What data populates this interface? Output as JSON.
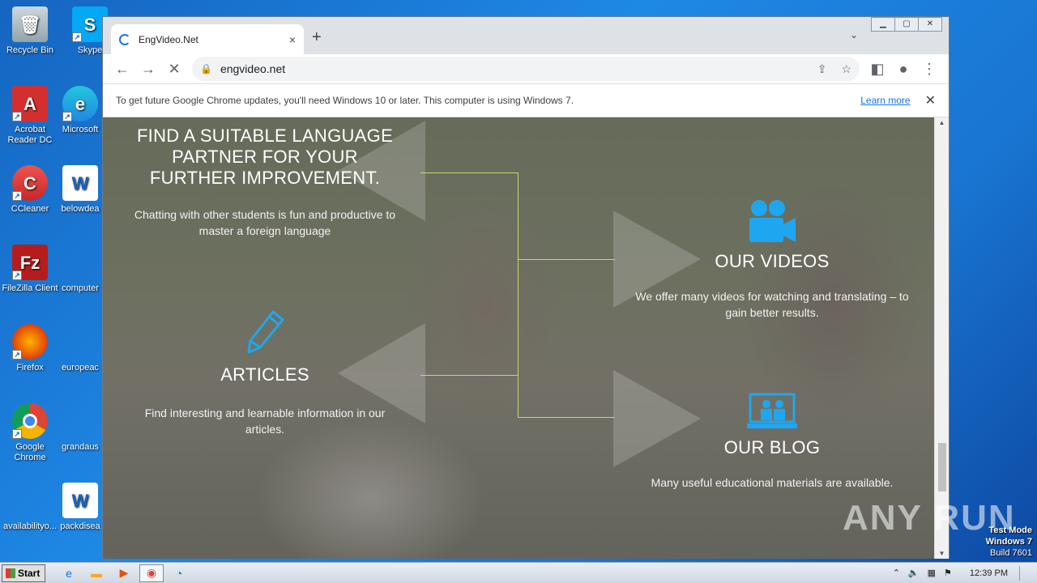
{
  "desktop": {
    "icons": [
      {
        "label": "Recycle Bin"
      },
      {
        "label": "Skype"
      },
      {
        "label": "Acrobat Reader DC"
      },
      {
        "label": "Microsoft"
      },
      {
        "label": "CCleaner"
      },
      {
        "label": "belowdea"
      },
      {
        "label": "FileZilla Client"
      },
      {
        "label": "computer"
      },
      {
        "label": "Firefox"
      },
      {
        "label": "europeac"
      },
      {
        "label": "Google Chrome"
      },
      {
        "label": "grandaus"
      },
      {
        "label": "availabilityo..."
      },
      {
        "label": "packdisea"
      }
    ],
    "watermark": "ANY RUN",
    "test_mode": [
      "Test Mode",
      "Windows 7",
      "Build 7601"
    ]
  },
  "browser": {
    "tab_title": "EngVideo.Net",
    "tab_close": "×",
    "new_tab": "+",
    "tab_list": "⌄",
    "url": "engvideo.net",
    "infobar": {
      "message": "To get future Google Chrome updates, you'll need Windows 10 or later. This computer is using Windows 7.",
      "learn_more": "Learn more",
      "close": "✕"
    }
  },
  "page": {
    "partner": {
      "heading": "FIND A SUITABLE LANGUAGE PARTNER FOR YOUR FURTHER IMPROVEMENT.",
      "desc": "Chatting with other students is fun and productive to master a foreign language"
    },
    "videos": {
      "heading": "OUR VIDEOS",
      "desc": "We offer many videos for watching and translating – to gain better results.",
      "icon": "video-camera-icon"
    },
    "articles": {
      "heading": "ARTICLES",
      "desc": "Find interesting and learnable information in our articles.",
      "icon": "pencil-icon"
    },
    "blog": {
      "heading": "OUR BLOG",
      "desc": "Many useful educational materials are available.",
      "icon": "presentation-icon"
    },
    "accent_color": "#1ea7f0"
  },
  "taskbar": {
    "start": "Start",
    "clock": "12:39 PM"
  }
}
